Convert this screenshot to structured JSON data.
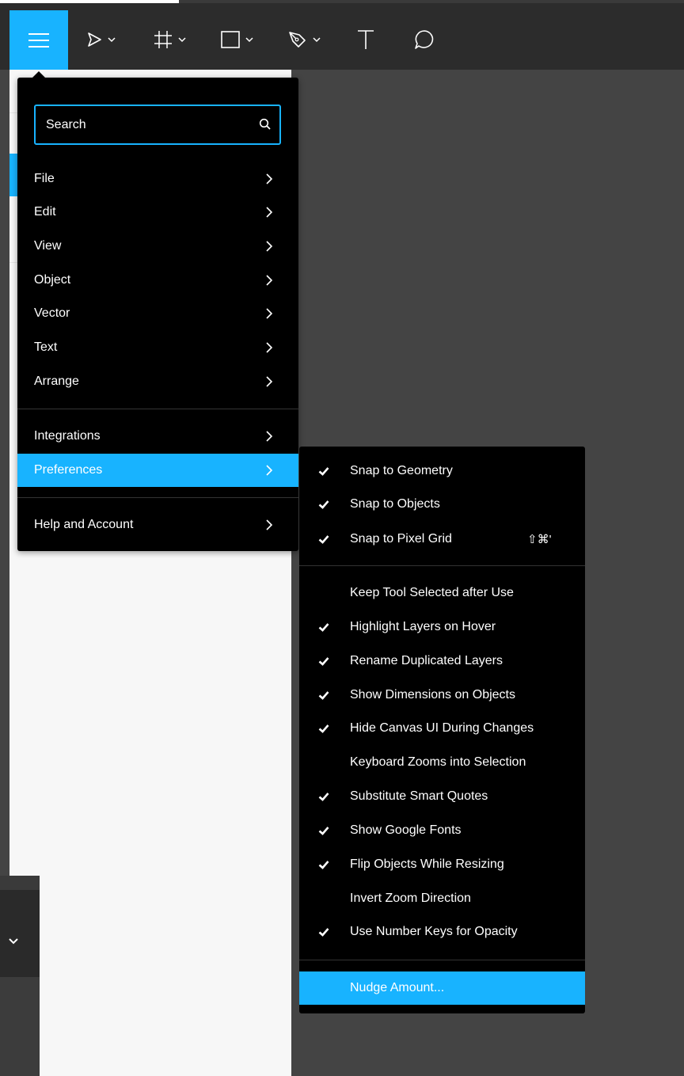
{
  "colors": {
    "accent": "#18b3ff",
    "menu_bg": "#000000",
    "toolbar_bg": "#2c2c2c",
    "canvas_bg": "#444444",
    "panel_bg": "#f7f7f7"
  },
  "toolbar": {
    "tools": [
      {
        "icon": "move-tool-icon",
        "has_caret": true
      },
      {
        "icon": "frame-tool-icon",
        "has_caret": true
      },
      {
        "icon": "rectangle-tool-icon",
        "has_caret": true
      },
      {
        "icon": "pen-tool-icon",
        "has_caret": true
      },
      {
        "icon": "text-tool-icon",
        "has_caret": false
      },
      {
        "icon": "comment-tool-icon",
        "has_caret": false
      }
    ]
  },
  "main_menu": {
    "search_placeholder": "Search",
    "items": [
      {
        "label": "File"
      },
      {
        "label": "Edit"
      },
      {
        "label": "View"
      },
      {
        "label": "Object"
      },
      {
        "label": "Vector"
      },
      {
        "label": "Text"
      },
      {
        "label": "Arrange"
      },
      {
        "label": "Integrations"
      },
      {
        "label": "Preferences",
        "active": true
      },
      {
        "label": "Help and Account"
      }
    ]
  },
  "preferences_menu": {
    "items": [
      {
        "label": "Snap to Geometry",
        "checked": true
      },
      {
        "label": "Snap to Objects",
        "checked": true
      },
      {
        "label": "Snap to Pixel Grid",
        "checked": true,
        "shortcut": "⇧⌘'"
      },
      {
        "label": "Keep Tool Selected after Use",
        "checked": false
      },
      {
        "label": "Highlight Layers on Hover",
        "checked": true
      },
      {
        "label": "Rename Duplicated Layers",
        "checked": true
      },
      {
        "label": "Show Dimensions on Objects",
        "checked": true
      },
      {
        "label": "Hide Canvas UI During Changes",
        "checked": true
      },
      {
        "label": "Keyboard Zooms into Selection",
        "checked": false
      },
      {
        "label": "Substitute Smart Quotes",
        "checked": true
      },
      {
        "label": "Show Google Fonts",
        "checked": true
      },
      {
        "label": "Flip Objects While Resizing",
        "checked": true
      },
      {
        "label": "Invert Zoom Direction",
        "checked": false
      },
      {
        "label": "Use Number Keys for Opacity",
        "checked": true
      },
      {
        "label": "Nudge Amount...",
        "checked": false,
        "active": true
      }
    ]
  }
}
